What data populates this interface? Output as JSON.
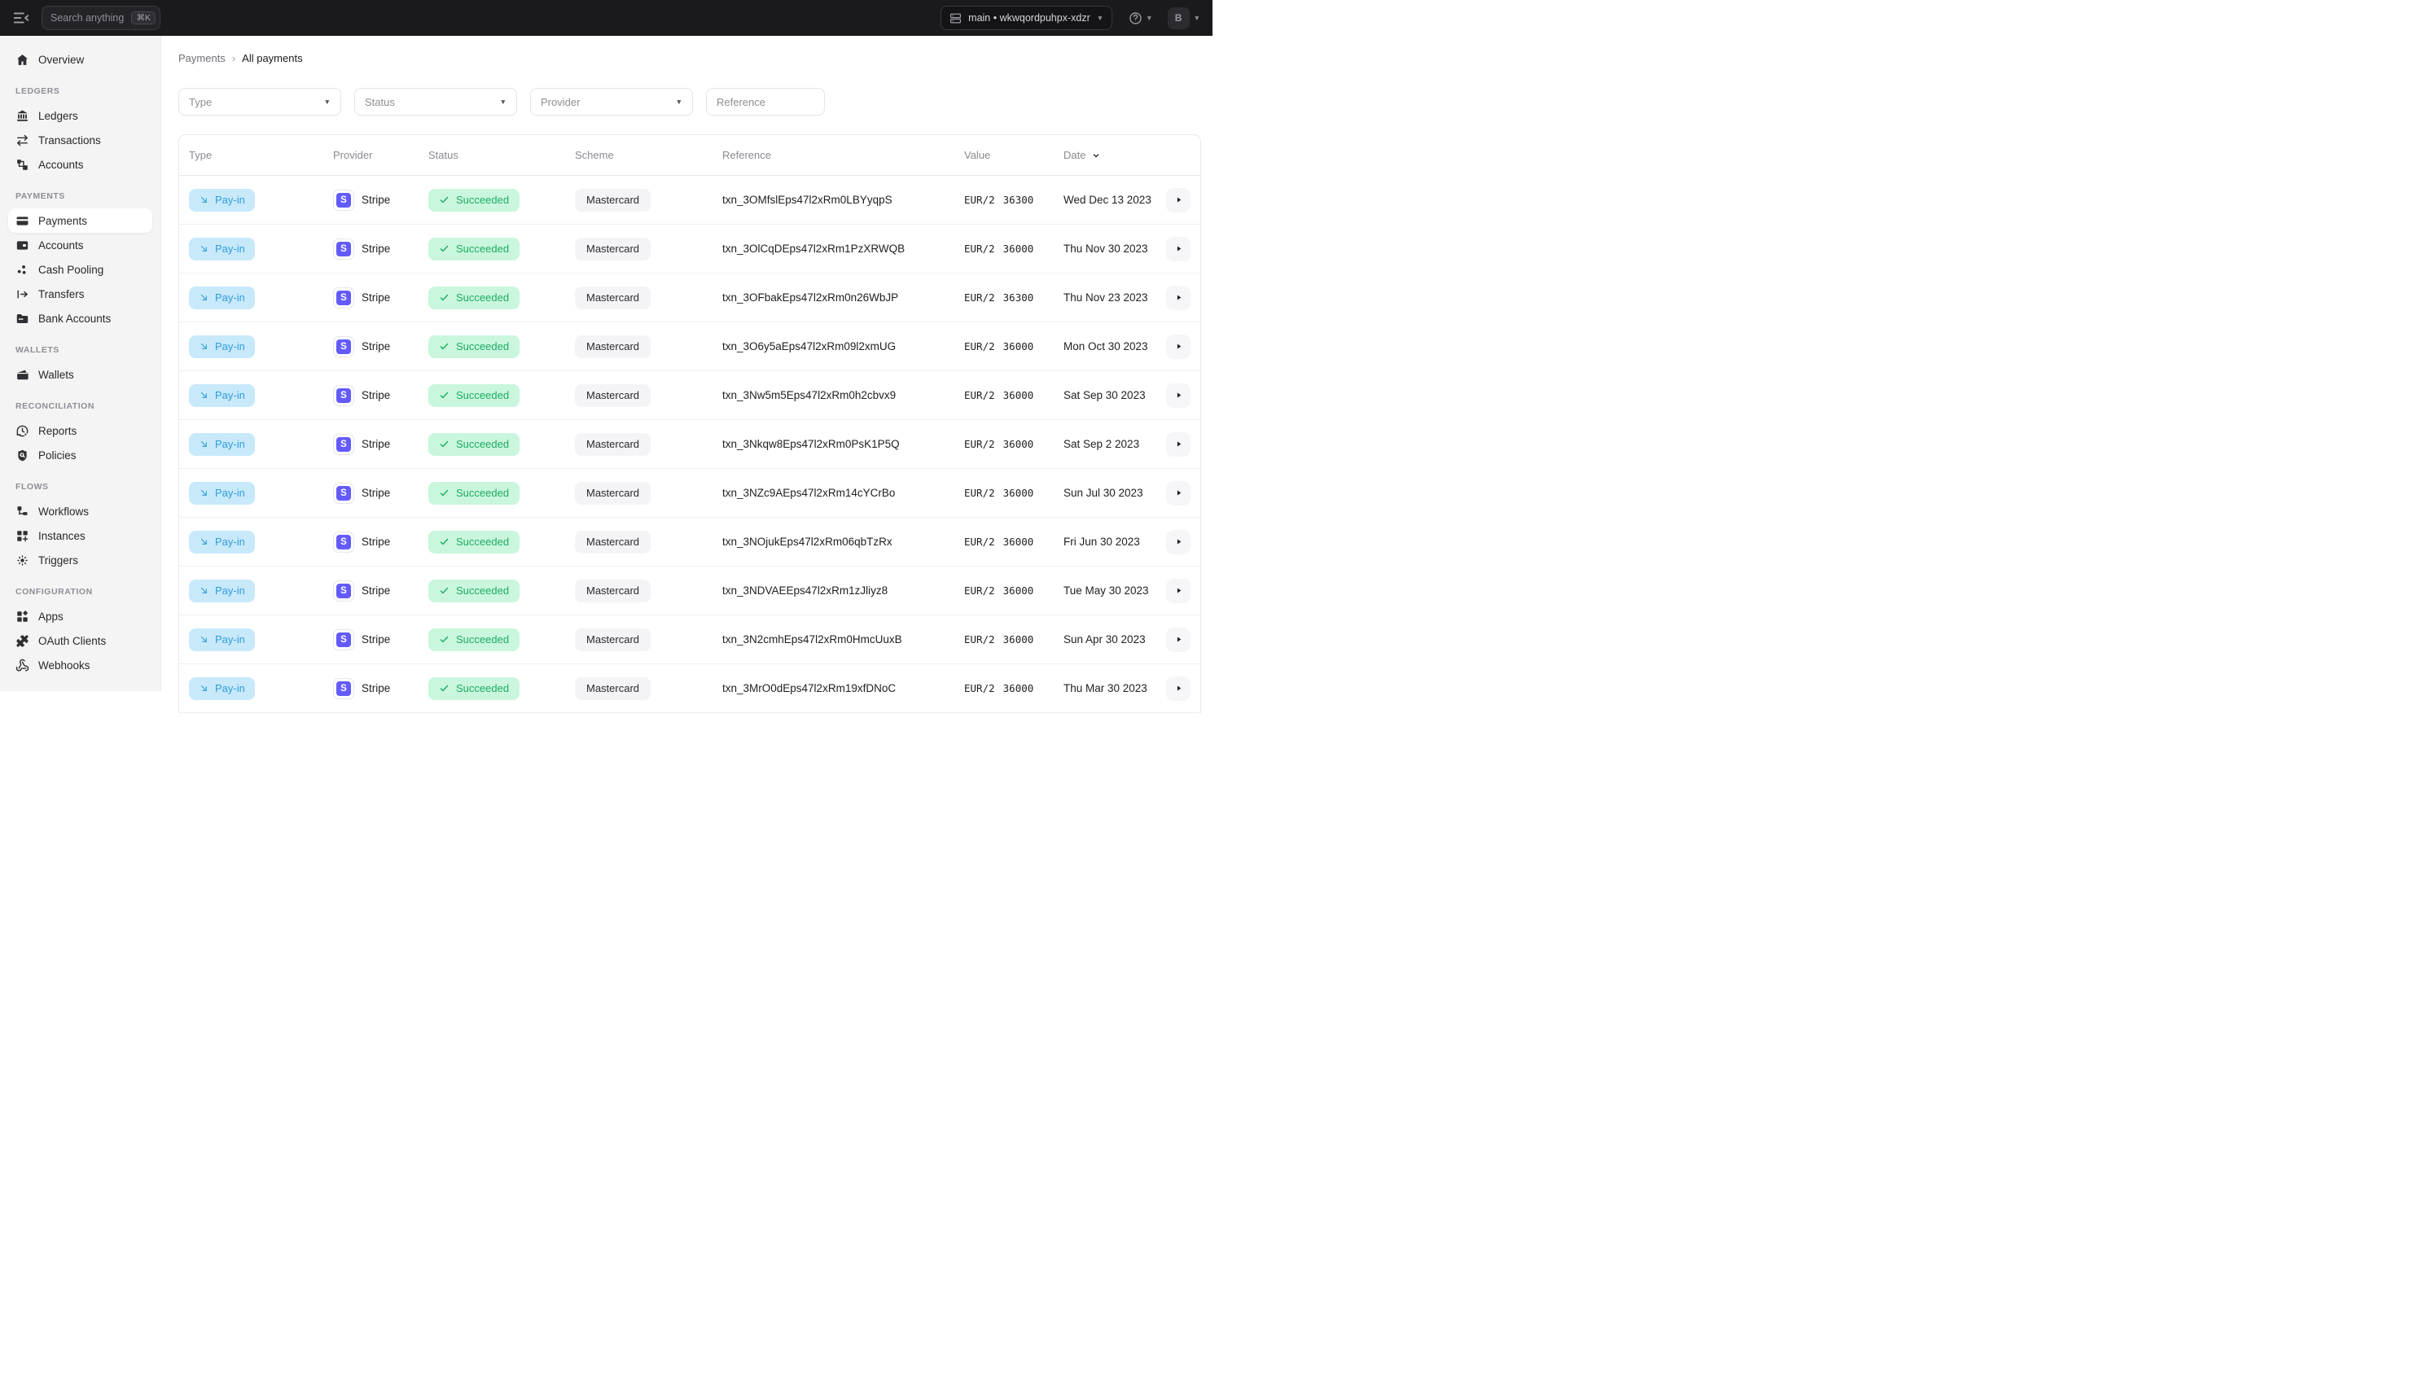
{
  "topbar": {
    "search_placeholder": "Search anything",
    "search_shortcut": "⌘K",
    "environment_label": "main • wkwqordpuhpx-xdzr",
    "avatar_initial": "B"
  },
  "sidebar": {
    "sections": [
      {
        "label": "",
        "items": [
          {
            "label": "Overview",
            "icon": "home"
          }
        ]
      },
      {
        "label": "LEDGERS",
        "items": [
          {
            "label": "Ledgers",
            "icon": "bank"
          },
          {
            "label": "Transactions",
            "icon": "arrows-left-right"
          },
          {
            "label": "Accounts",
            "icon": "hierarchy"
          }
        ]
      },
      {
        "label": "PAYMENTS",
        "items": [
          {
            "label": "Payments",
            "icon": "credit-card",
            "active": true
          },
          {
            "label": "Accounts",
            "icon": "wallet-card"
          },
          {
            "label": "Cash Pooling",
            "icon": "dots-triangle"
          },
          {
            "label": "Transfers",
            "icon": "arrow-right-from-line"
          },
          {
            "label": "Bank Accounts",
            "icon": "folder"
          }
        ]
      },
      {
        "label": "WALLETS",
        "items": [
          {
            "label": "Wallets",
            "icon": "wallet"
          }
        ]
      },
      {
        "label": "RECONCILIATION",
        "items": [
          {
            "label": "Reports",
            "icon": "history-gear"
          },
          {
            "label": "Policies",
            "icon": "shield-search"
          }
        ]
      },
      {
        "label": "FLOWS",
        "items": [
          {
            "label": "Workflows",
            "icon": "workflow"
          },
          {
            "label": "Instances",
            "icon": "grid-plus"
          },
          {
            "label": "Triggers",
            "icon": "sparkle"
          }
        ]
      },
      {
        "label": "CONFIGURATION",
        "items": [
          {
            "label": "Apps",
            "icon": "blocks"
          },
          {
            "label": "OAuth Clients",
            "icon": "puzzle"
          },
          {
            "label": "Webhooks",
            "icon": "webhook"
          }
        ]
      }
    ]
  },
  "breadcrumb": {
    "parent": "Payments",
    "separator": "›",
    "current": "All payments"
  },
  "filters": [
    {
      "label": "Type",
      "kind": "select"
    },
    {
      "label": "Status",
      "kind": "select"
    },
    {
      "label": "Provider",
      "kind": "select"
    },
    {
      "label": "Reference",
      "kind": "input"
    }
  ],
  "table": {
    "columns": [
      "Type",
      "Provider",
      "Status",
      "Scheme",
      "Reference",
      "Value",
      "Date"
    ],
    "sorted_column": "Date",
    "rows": [
      {
        "type": "Pay-in",
        "provider": "Stripe",
        "status": "Succeeded",
        "scheme": "Mastercard",
        "reference": "txn_3OMfslEps47l2xRm0LBYyqpS",
        "value_currency": "EUR/2",
        "value_amount": "36300",
        "date": "Wed Dec 13 2023"
      },
      {
        "type": "Pay-in",
        "provider": "Stripe",
        "status": "Succeeded",
        "scheme": "Mastercard",
        "reference": "txn_3OlCqDEps47l2xRm1PzXRWQB",
        "value_currency": "EUR/2",
        "value_amount": "36000",
        "date": "Thu Nov 30 2023"
      },
      {
        "type": "Pay-in",
        "provider": "Stripe",
        "status": "Succeeded",
        "scheme": "Mastercard",
        "reference": "txn_3OFbakEps47l2xRm0n26WbJP",
        "value_currency": "EUR/2",
        "value_amount": "36300",
        "date": "Thu Nov 23 2023"
      },
      {
        "type": "Pay-in",
        "provider": "Stripe",
        "status": "Succeeded",
        "scheme": "Mastercard",
        "reference": "txn_3O6y5aEps47l2xRm09l2xmUG",
        "value_currency": "EUR/2",
        "value_amount": "36000",
        "date": "Mon Oct 30 2023"
      },
      {
        "type": "Pay-in",
        "provider": "Stripe",
        "status": "Succeeded",
        "scheme": "Mastercard",
        "reference": "txn_3Nw5m5Eps47l2xRm0h2cbvx9",
        "value_currency": "EUR/2",
        "value_amount": "36000",
        "date": "Sat Sep 30 2023"
      },
      {
        "type": "Pay-in",
        "provider": "Stripe",
        "status": "Succeeded",
        "scheme": "Mastercard",
        "reference": "txn_3Nkqw8Eps47l2xRm0PsK1P5Q",
        "value_currency": "EUR/2",
        "value_amount": "36000",
        "date": "Sat Sep 2 2023"
      },
      {
        "type": "Pay-in",
        "provider": "Stripe",
        "status": "Succeeded",
        "scheme": "Mastercard",
        "reference": "txn_3NZc9AEps47l2xRm14cYCrBo",
        "value_currency": "EUR/2",
        "value_amount": "36000",
        "date": "Sun Jul 30 2023"
      },
      {
        "type": "Pay-in",
        "provider": "Stripe",
        "status": "Succeeded",
        "scheme": "Mastercard",
        "reference": "txn_3NOjukEps47l2xRm06qbTzRx",
        "value_currency": "EUR/2",
        "value_amount": "36000",
        "date": "Fri Jun 30 2023"
      },
      {
        "type": "Pay-in",
        "provider": "Stripe",
        "status": "Succeeded",
        "scheme": "Mastercard",
        "reference": "txn_3NDVAEEps47l2xRm1zJliyz8",
        "value_currency": "EUR/2",
        "value_amount": "36000",
        "date": "Tue May 30 2023"
      },
      {
        "type": "Pay-in",
        "provider": "Stripe",
        "status": "Succeeded",
        "scheme": "Mastercard",
        "reference": "txn_3N2cmhEps47l2xRm0HmcUuxB",
        "value_currency": "EUR/2",
        "value_amount": "36000",
        "date": "Sun Apr 30 2023"
      },
      {
        "type": "Pay-in",
        "provider": "Stripe",
        "status": "Succeeded",
        "scheme": "Mastercard",
        "reference": "txn_3MrO0dEps47l2xRm19xfDNoC",
        "value_currency": "EUR/2",
        "value_amount": "36000",
        "date": "Thu Mar 30 2023"
      }
    ]
  },
  "colors": {
    "topbar_bg": "#1a1a1d",
    "sidebar_bg": "#f4f4f5",
    "payin_badge_bg": "#c8e9fa",
    "payin_badge_text": "#2e9ddd",
    "success_badge_bg": "#c9f6dd",
    "success_badge_text": "#1eac64",
    "stripe_purple": "#635bff",
    "scheme_chip_bg": "#f4f4f6"
  }
}
